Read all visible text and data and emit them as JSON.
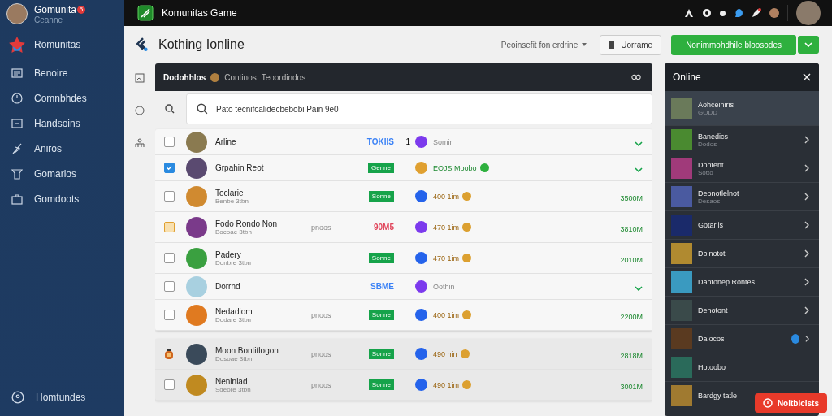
{
  "sidebar": {
    "profile": {
      "name": "Gomunita",
      "badge": "5",
      "subtitle": "Ceanne"
    },
    "brand": "Romunitas",
    "items": [
      {
        "label": "Benoire"
      },
      {
        "label": "Comnbhdes"
      },
      {
        "label": "Handsoins"
      },
      {
        "label": "Aniros"
      },
      {
        "label": "Gomarlos"
      },
      {
        "label": "Gomdoots"
      }
    ],
    "footer": "Homtundes"
  },
  "top_bar": {
    "title": "Komunitas Game"
  },
  "header": {
    "title": "Kothing Ionline",
    "dropdown": "Peoinsefit fon erdrine",
    "button": "Uorrame",
    "primary_button": "Nonimmohdhile bloosodes"
  },
  "panel": {
    "tabs": [
      {
        "label": "Dodohhlos",
        "selected": true
      },
      {
        "label": "Continos",
        "selected": false
      },
      {
        "label": "Teoordindos",
        "selected": false
      }
    ],
    "search": {
      "placeholder": "Pato tecnifcalidecbebobi Pain 9e0"
    },
    "rows": [
      {
        "kind": "checkbox",
        "checked": false,
        "flagged": false,
        "name": "Arline",
        "badge": {
          "kind": "text",
          "text": "TOKIIS",
          "color": "#3b82f6"
        },
        "count": "1",
        "color": "#7c3aed",
        "time": "Somin",
        "coin": false,
        "online": false,
        "end": {
          "kind": "chevron"
        }
      },
      {
        "kind": "checkbox",
        "checked": true,
        "flagged": false,
        "name": "Grpahin Reot",
        "badge": {
          "kind": "tag",
          "text": "Genne",
          "color": "#16a34a"
        },
        "color": "#e0a030",
        "time": "EOJS Moobo",
        "coin": false,
        "online": true,
        "end": {
          "kind": "chevron"
        }
      },
      {
        "kind": "checkbox",
        "checked": false,
        "flagged": false,
        "name": "Toclarie",
        "sub": "Benbe 3tbn",
        "badge": {
          "kind": "tag",
          "text": "Sonne",
          "color": "#16a34a"
        },
        "color": "#2563eb",
        "time": "400 1im",
        "coin": true,
        "online": false,
        "end": {
          "kind": "amount",
          "text": "3500M"
        }
      },
      {
        "kind": "checkbox",
        "checked": false,
        "flagged": true,
        "name": "Fodo Rondo Non",
        "sub": "Bocoae 3tbn",
        "extra": "pnoos",
        "badge": {
          "kind": "text",
          "text": "90M5",
          "color": "#e0445a"
        },
        "color": "#7c3aed",
        "time": "470 1im",
        "coin": true,
        "online": false,
        "end": {
          "kind": "amount",
          "text": "3810M"
        }
      },
      {
        "kind": "checkbox",
        "checked": false,
        "flagged": false,
        "name": "Padery",
        "sub": "Donbre 3tbn",
        "badge": {
          "kind": "tag",
          "text": "Sonne",
          "color": "#16a34a"
        },
        "color": "#2563eb",
        "time": "470 1im",
        "coin": true,
        "online": false,
        "end": {
          "kind": "amount",
          "text": "2010M"
        }
      },
      {
        "kind": "checkbox",
        "checked": false,
        "flagged": false,
        "name": "Dorrnd",
        "badge": {
          "kind": "text",
          "text": "SBME",
          "color": "#3b82f6"
        },
        "color": "#7c3aed",
        "time": "Oothin",
        "coin": false,
        "online": false,
        "end": {
          "kind": "chevron"
        }
      },
      {
        "kind": "checkbox",
        "checked": false,
        "flagged": false,
        "name": "Nedadiom",
        "sub": "Dodare 3tbn",
        "extra": "pnoos",
        "badge": {
          "kind": "tag",
          "text": "Sonne",
          "color": "#16a34a"
        },
        "color": "#2563eb",
        "time": "400 1im",
        "coin": true,
        "online": false,
        "end": {
          "kind": "amount",
          "text": "2200M"
        }
      }
    ],
    "more_rows": [
      {
        "kind": "icon",
        "name": "Moon Bontitlogon",
        "sub": "Dosoae 3tbn",
        "extra": "pnoos",
        "badge": {
          "kind": "tag",
          "text": "Sonne",
          "color": "#16a34a"
        },
        "color": "#2563eb",
        "time": "490 hin",
        "coin": true,
        "online": false,
        "end": {
          "kind": "amount",
          "text": "2818M"
        }
      },
      {
        "kind": "checkbox",
        "checked": false,
        "flagged": false,
        "name": "Neninlad",
        "sub": "Sdeore 3tbn",
        "extra": "pnoos",
        "badge": {
          "kind": "tag",
          "text": "Sonne",
          "color": "#16a34a"
        },
        "color": "#2563eb",
        "time": "490 1im",
        "coin": true,
        "online": false,
        "end": {
          "kind": "amount",
          "text": "3001M"
        }
      }
    ]
  },
  "online": {
    "title": "Online",
    "items": [
      {
        "name": "Aohceiniris",
        "sub": "GODD",
        "selected": true,
        "arrow": false,
        "badge": false
      },
      {
        "name": "Banedics",
        "sub": "Dodos",
        "selected": false,
        "arrow": true,
        "badge": false
      },
      {
        "name": "Dontent",
        "sub": "Sotto",
        "selected": false,
        "arrow": true,
        "badge": false
      },
      {
        "name": "Deonotlelnot",
        "sub": "Desaos",
        "selected": false,
        "arrow": true,
        "badge": false
      },
      {
        "name": "Gotarlis",
        "selected": false,
        "arrow": true,
        "badge": false
      },
      {
        "name": "Dbinotot",
        "selected": false,
        "arrow": true,
        "badge": false
      },
      {
        "name": "Dantonep Rontes",
        "selected": false,
        "arrow": true,
        "badge": false
      },
      {
        "name": "Denotont",
        "selected": false,
        "arrow": true,
        "badge": false
      },
      {
        "name": "Dalocos",
        "selected": false,
        "arrow": true,
        "badge": true
      },
      {
        "name": "Hotoobo",
        "selected": false,
        "arrow": false,
        "badge": false
      },
      {
        "name": "Bardgy tatle",
        "selected": false,
        "arrow": false,
        "badge": false
      }
    ],
    "notify": "Noltbicists"
  }
}
